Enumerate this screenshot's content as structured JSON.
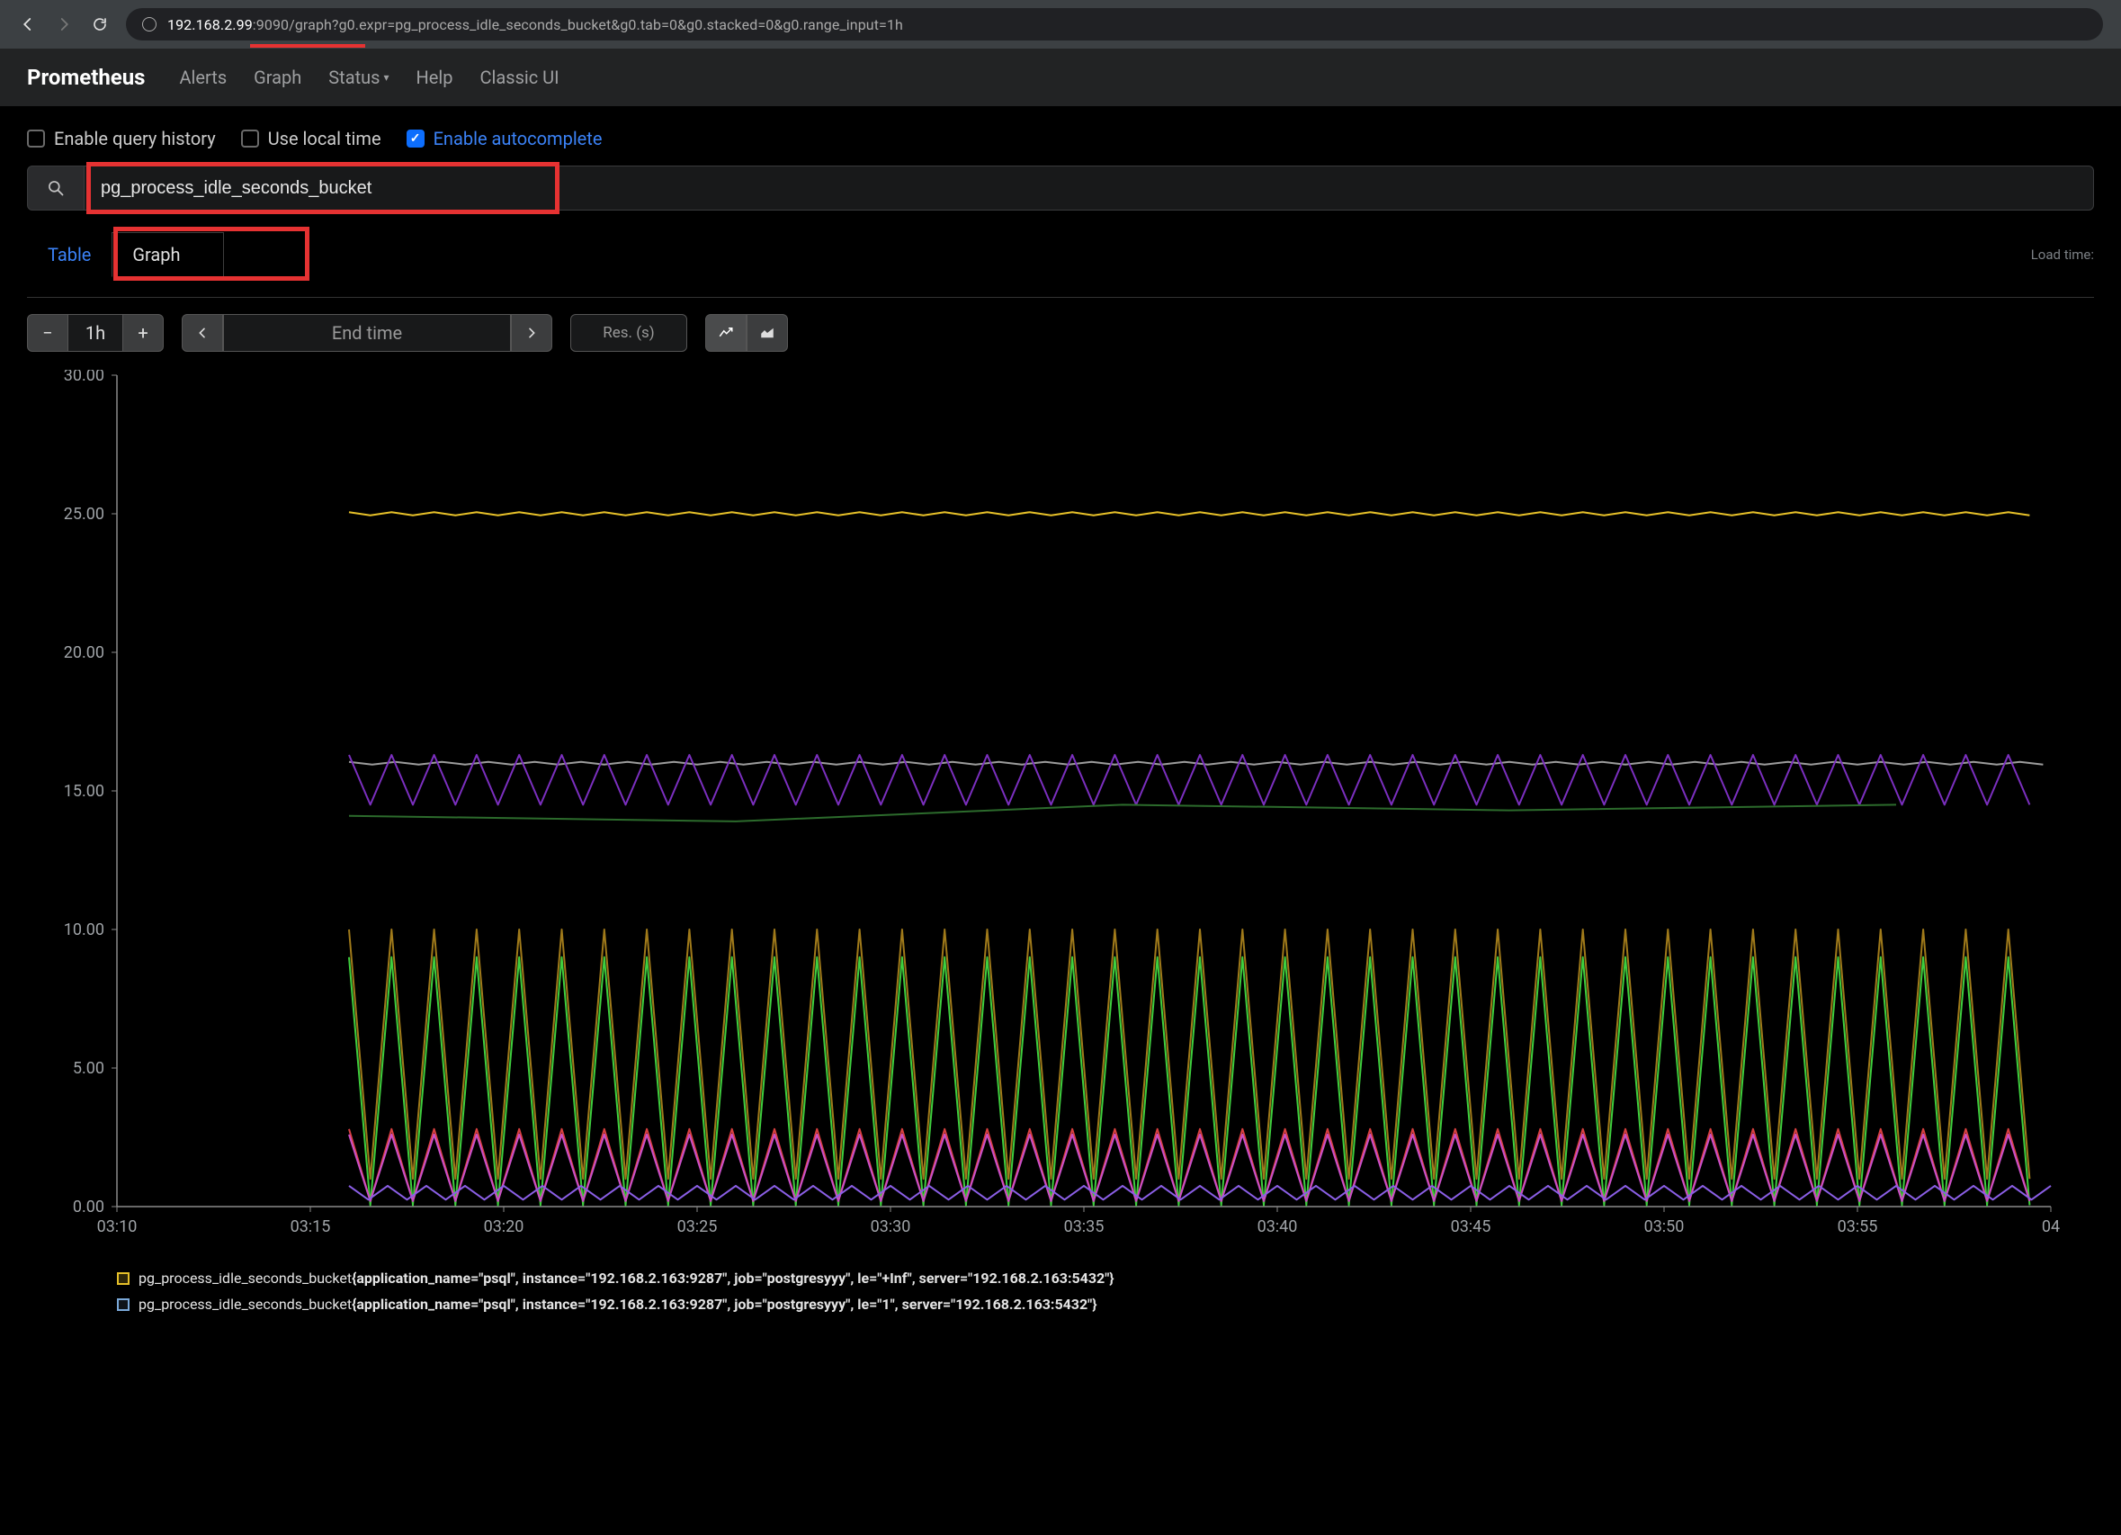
{
  "browser": {
    "url_host": "192.168.2.99",
    "url_rest": ":9090/graph?g0.expr=pg_process_idle_seconds_bucket&g0.tab=0&g0.stacked=0&g0.range_input=1h"
  },
  "navbar": {
    "brand": "Prometheus",
    "links": [
      "Alerts",
      "Graph",
      "Status",
      "Help",
      "Classic UI"
    ]
  },
  "options": {
    "history_label": "Enable query history",
    "localtime_label": "Use local time",
    "autocomplete_label": "Enable autocomplete",
    "autocomplete_checked": true
  },
  "query": {
    "expression": "pg_process_idle_seconds_bucket"
  },
  "tabs": {
    "table": "Table",
    "graph": "Graph",
    "load_time": "Load time:"
  },
  "controls": {
    "range": "1h",
    "end_time_placeholder": "End time",
    "res_placeholder": "Res. (s)",
    "minus": "−",
    "plus": "+"
  },
  "legend": [
    {
      "color": "#e6c029",
      "metric": "pg_process_idle_seconds_bucket",
      "labels": "{application_name=\"psql\", instance=\"192.168.2.163:9287\", job=\"postgresyyy\", le=\"+Inf\", server=\"192.168.2.163:5432\"}"
    },
    {
      "color": "#7aa8d8",
      "metric": "pg_process_idle_seconds_bucket",
      "labels": "{application_name=\"psql\", instance=\"192.168.2.163:9287\", job=\"postgresyyy\", le=\"1\", server=\"192.168.2.163:5432\"}"
    }
  ],
  "chart_data": {
    "type": "line",
    "xlabel": "",
    "ylabel": "",
    "ylim": [
      0,
      30
    ],
    "x_ticks": [
      "03:10",
      "03:15",
      "03:20",
      "03:25",
      "03:30",
      "03:35",
      "03:40",
      "03:45",
      "03:50",
      "03:55",
      "04"
    ],
    "y_ticks": [
      0,
      5,
      10,
      15,
      20,
      25,
      30
    ],
    "x_range_minutes": [
      190,
      240
    ],
    "data_start_minute": 196,
    "series": [
      {
        "name": "le=+Inf",
        "color": "#e6c029",
        "baseline": 25,
        "amplitude": 0.06,
        "period_min": 1.1
      },
      {
        "name": "grey-16",
        "color": "#9c9c9c",
        "baseline": 16,
        "amplitude": 0.05,
        "period_min": 1.2
      },
      {
        "name": "purple-15",
        "color": "#7b2fbf",
        "baseline": 15.4,
        "amplitude": 0.9,
        "period_min": 1.1
      },
      {
        "name": "darkgreen-14",
        "color": "#2c6b2c",
        "baseline": 14,
        "amplitude": 0.1,
        "period_min": 20,
        "step_at": 215,
        "step_to": 14.4
      },
      {
        "name": "olive-8",
        "color": "#a07a1a",
        "baseline": 5.5,
        "amplitude": 4.5,
        "period_min": 1.1
      },
      {
        "name": "green-6",
        "color": "#3ecf3e",
        "baseline": 4.5,
        "amplitude": 4.5,
        "period_min": 1.1
      },
      {
        "name": "red-2",
        "color": "#d84040",
        "baseline": 1.5,
        "amplitude": 1.3,
        "period_min": 1.1
      },
      {
        "name": "magenta-2",
        "color": "#c94fc9",
        "baseline": 1.4,
        "amplitude": 1.2,
        "period_min": 1.1
      },
      {
        "name": "violet-0.5",
        "color": "#8b5fe6",
        "baseline": 0.5,
        "amplitude": 0.25,
        "period_min": 1.0
      }
    ]
  }
}
